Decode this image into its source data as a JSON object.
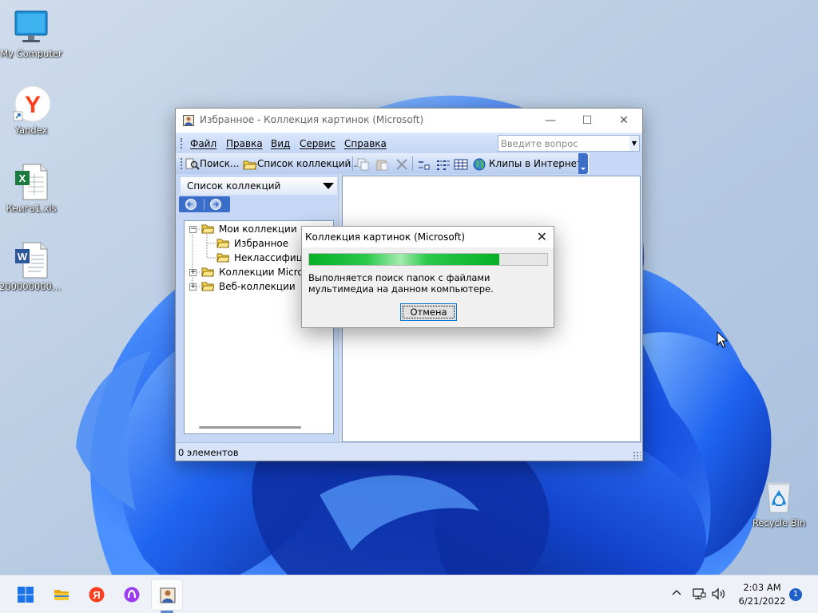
{
  "desktop": {
    "icons": [
      {
        "label": "My Computer",
        "icon": "monitor-icon"
      },
      {
        "label": "Yandex",
        "icon": "yandex-browser-icon"
      },
      {
        "label": "Книга1.xls",
        "icon": "excel-file-icon"
      },
      {
        "label": "2000000000...",
        "icon": "word-file-icon"
      },
      {
        "label": "Recycle Bin",
        "icon": "recycle-bin-icon"
      }
    ]
  },
  "main_window": {
    "title": "Избранное - Коллекция картинок (Microsoft)",
    "menu": [
      {
        "label": "Файл"
      },
      {
        "label": "Правка"
      },
      {
        "label": "Вид"
      },
      {
        "label": "Сервис"
      },
      {
        "label": "Справка"
      }
    ],
    "ask_placeholder": "Введите вопрос",
    "toolbar": {
      "search_label": "Поиск...",
      "collections_label": "Список коллекций...",
      "online_label": "Клипы в Интернете"
    },
    "task_pane": {
      "title": "Список коллекций",
      "tree": [
        {
          "label": "Мои коллекции"
        },
        {
          "label": "Избранное"
        },
        {
          "label": "Неклассифицир"
        },
        {
          "label": "Коллекции Microso"
        },
        {
          "label": "Веб-коллекции"
        }
      ]
    },
    "status": "0 элементов"
  },
  "dialog": {
    "title": "Коллекция картинок (Microsoft)",
    "message": "Выполняется поиск папок с файлами мультимедиа на данном компьютере.",
    "progress_percent": 80,
    "cancel_label": "Отмена"
  },
  "taskbar": {
    "time": "2:03 AM",
    "date": "6/21/2022",
    "notifications": "1"
  },
  "colors": {
    "progress_green": "#06b025",
    "office_toolbar_blue": "#c6d8f5",
    "taskbar_bg": "#eef2f8"
  }
}
